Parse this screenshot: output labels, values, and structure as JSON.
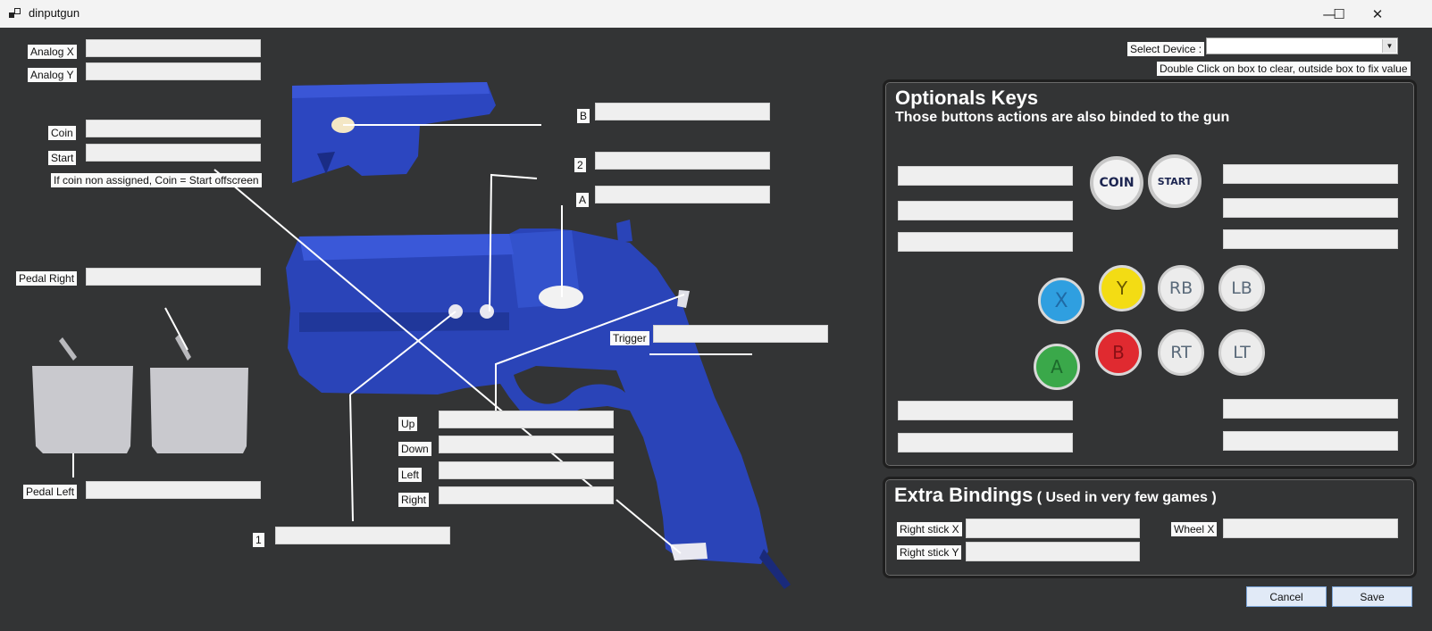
{
  "window": {
    "title": "dinputgun",
    "minimize": "—",
    "maximize": "☐",
    "close": "✕"
  },
  "device": {
    "label": "Select Device :",
    "value": "",
    "hint": "Double Click on box to clear, outside box to fix value"
  },
  "left": {
    "analog_x": "Analog X",
    "analog_y": "Analog Y",
    "coin": "Coin",
    "start": "Start",
    "coin_note": "If coin non assigned, Coin = Start offscreen",
    "pedal_right": "Pedal Right",
    "pedal_left": "Pedal Left"
  },
  "gun": {
    "b": "B",
    "two": "2",
    "a": "A",
    "trigger": "Trigger",
    "up": "Up",
    "down": "Down",
    "left": "Left",
    "right": "Right",
    "one": "1"
  },
  "optionals": {
    "title": "Optionals Keys",
    "subtitle": "Those buttons actions are also binded to the gun",
    "buttons": {
      "coin": "COIN",
      "start": "START",
      "x": "X",
      "y": "Y",
      "rb": "RB",
      "lb": "LB",
      "a": "A",
      "b": "B",
      "rt": "RT",
      "lt": "LT"
    }
  },
  "extra": {
    "title": "Extra Bindings",
    "subtitle": "( Used in very few games )",
    "right_stick_x": "Right stick X",
    "right_stick_y": "Right stick Y",
    "wheel_x": "Wheel X"
  },
  "actions": {
    "cancel": "Cancel",
    "save": "Save"
  },
  "colors": {
    "background": "#333435",
    "gun_blue": "#2a44b8",
    "x_blue": "#2f9fe0",
    "y_yellow": "#f3dc14",
    "a_green": "#3aa84a",
    "b_red": "#e02a30"
  }
}
